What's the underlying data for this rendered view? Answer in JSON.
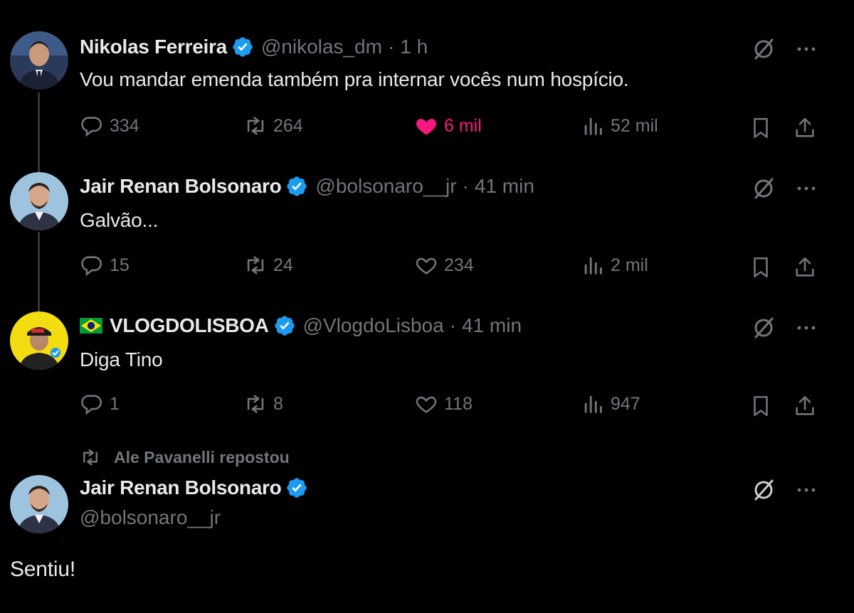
{
  "tweets": [
    {
      "name": "Nikolas Ferreira",
      "handle": "@nikolas_dm",
      "time": "1 h",
      "text": "Vou mandar emenda também pra internar vocês num hospício.",
      "replies": "334",
      "reposts": "264",
      "likes": "6 mil",
      "views": "52 mil",
      "liked": true
    },
    {
      "name": "Jair Renan Bolsonaro",
      "handle": "@bolsonaro__jr",
      "time": "41 min",
      "text": "Galvão...",
      "replies": "15",
      "reposts": "24",
      "likes": "234",
      "views": "2 mil",
      "liked": false
    },
    {
      "name": "VLOGDOLISBOA",
      "handle": "@VlogdoLisboa",
      "time": "41 min",
      "text": "Diga Tino",
      "replies": "1",
      "reposts": "8",
      "likes": "118",
      "views": "947",
      "liked": false
    }
  ],
  "repost_note": "Ale Pavanelli repostou",
  "main_tweet": {
    "name": "Jair Renan Bolsonaro",
    "handle": "@bolsonaro__jr",
    "text": "Sentiu!"
  },
  "separator": "·",
  "colors": {
    "background": "#000000",
    "text": "#e7e9ea",
    "muted": "#71767b",
    "verified": "#1d9bf0",
    "like": "#f91880"
  },
  "icons": [
    "reply-icon",
    "repost-icon",
    "like-icon",
    "views-icon",
    "bookmark-icon",
    "share-icon",
    "grok-icon",
    "more-icon",
    "verified-icon",
    "brazil-flag-icon"
  ]
}
